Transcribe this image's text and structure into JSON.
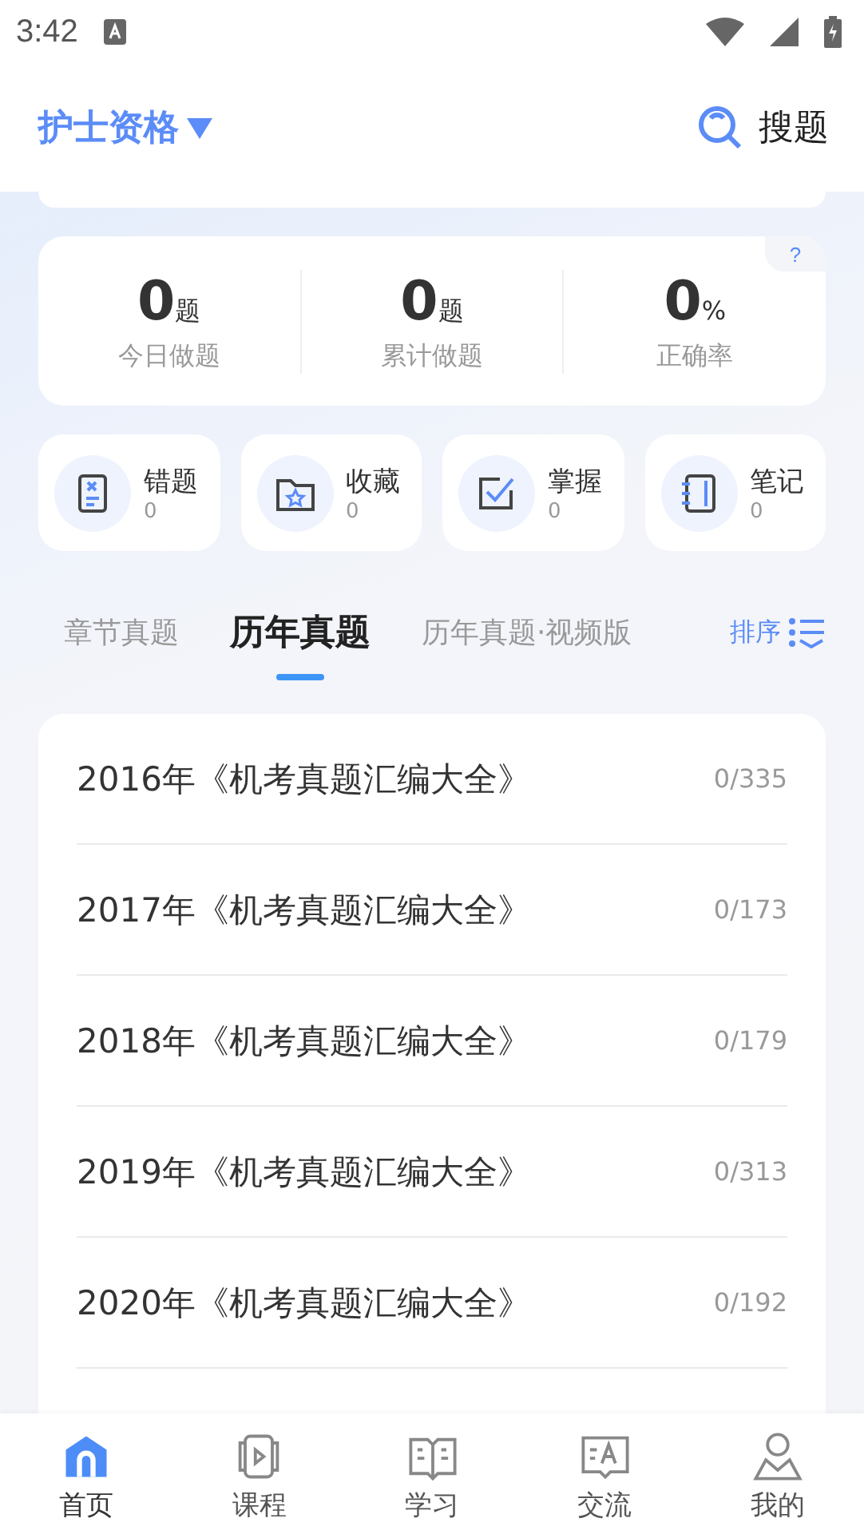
{
  "status_bar": {
    "time": "3:42"
  },
  "header": {
    "exam": "护士资格",
    "search": "搜题"
  },
  "stats": [
    {
      "value": "0",
      "unit": "题",
      "label": "今日做题"
    },
    {
      "value": "0",
      "unit": "题",
      "label": "累计做题"
    },
    {
      "value": "0",
      "unit": "%",
      "label": "正确率"
    }
  ],
  "help": "?",
  "shortcuts": [
    {
      "label": "错题",
      "count": "0"
    },
    {
      "label": "收藏",
      "count": "0"
    },
    {
      "label": "掌握",
      "count": "0"
    },
    {
      "label": "笔记",
      "count": "0"
    }
  ],
  "tabs": [
    {
      "label": "章节真题",
      "selected": false
    },
    {
      "label": "历年真题",
      "selected": true
    },
    {
      "label": "历年真题·视频版",
      "selected": false
    }
  ],
  "sort": "排序",
  "papers": [
    {
      "title": "2016年《机考真题汇编大全》",
      "progress": "0/335"
    },
    {
      "title": "2017年《机考真题汇编大全》",
      "progress": "0/173"
    },
    {
      "title": "2018年《机考真题汇编大全》",
      "progress": "0/179"
    },
    {
      "title": "2019年《机考真题汇编大全》",
      "progress": "0/313"
    },
    {
      "title": "2020年《机考真题汇编大全》",
      "progress": "0/192"
    }
  ],
  "nav": [
    {
      "label": "首页",
      "selected": true
    },
    {
      "label": "课程",
      "selected": false
    },
    {
      "label": "学习",
      "selected": false
    },
    {
      "label": "交流",
      "selected": false
    },
    {
      "label": "我的",
      "selected": false
    }
  ]
}
